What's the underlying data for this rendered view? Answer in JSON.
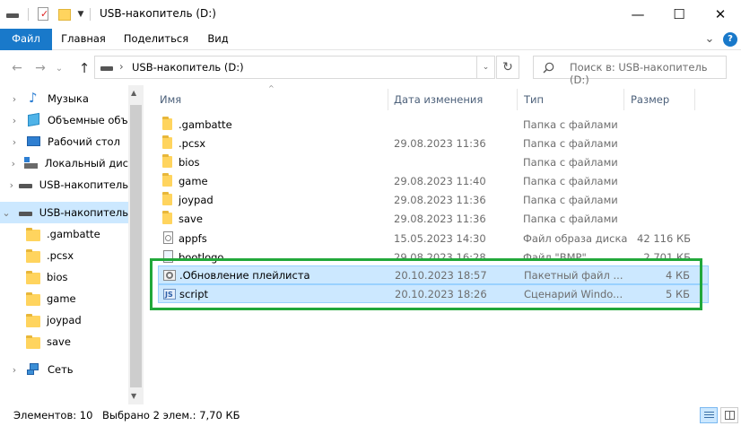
{
  "window": {
    "title": "USB-накопитель (D:)",
    "minimize_glyph": "—",
    "maximize_glyph": "☐",
    "close_glyph": "✕"
  },
  "ribbon": {
    "tabs": [
      "Файл",
      "Главная",
      "Поделиться",
      "Вид"
    ],
    "expand_glyph": "⌄",
    "help_glyph": "?"
  },
  "nav": {
    "back_glyph": "←",
    "forward_glyph": "→",
    "recent_glyph": "⌄",
    "up_glyph": "↑",
    "address_sep": "›",
    "address": "USB-накопитель (D:)",
    "refresh_glyph": "↻",
    "search_placeholder": "Поиск в: USB-накопитель (D:)"
  },
  "sidebar": {
    "items": [
      {
        "label": "Музыка",
        "icon": "music-icon"
      },
      {
        "label": "Объемные объ",
        "icon": "3d-objects-icon"
      },
      {
        "label": "Рабочий стол",
        "icon": "desktop-icon"
      },
      {
        "label": "Локальный дис",
        "icon": "local-disk-icon"
      },
      {
        "label": "USB-накопитель",
        "icon": "usb-drive-icon"
      },
      {
        "label": "USB-накопитель",
        "icon": "usb-drive-icon",
        "selected": true
      },
      {
        "label": ".gambatte",
        "icon": "folder-icon"
      },
      {
        "label": ".pcsx",
        "icon": "folder-icon"
      },
      {
        "label": "bios",
        "icon": "folder-icon"
      },
      {
        "label": "game",
        "icon": "folder-icon"
      },
      {
        "label": "joypad",
        "icon": "folder-icon"
      },
      {
        "label": "save",
        "icon": "folder-icon"
      },
      {
        "label": "Сеть",
        "icon": "network-icon"
      }
    ]
  },
  "columns": {
    "name": "Имя",
    "date": "Дата изменения",
    "type": "Тип",
    "size": "Размер"
  },
  "files": [
    {
      "name": ".gambatte",
      "date": "",
      "type": "Папка с файлами",
      "size": "",
      "icon": "folder-icon"
    },
    {
      "name": ".pcsx",
      "date": "29.08.2023 11:36",
      "type": "Папка с файлами",
      "size": "",
      "icon": "folder-icon"
    },
    {
      "name": "bios",
      "date": "",
      "type": "Папка с файлами",
      "size": "",
      "icon": "folder-icon"
    },
    {
      "name": "game",
      "date": "29.08.2023 11:40",
      "type": "Папка с файлами",
      "size": "",
      "icon": "folder-icon"
    },
    {
      "name": "joypad",
      "date": "29.08.2023 11:36",
      "type": "Папка с файлами",
      "size": "",
      "icon": "folder-icon"
    },
    {
      "name": "save",
      "date": "29.08.2023 11:36",
      "type": "Папка с файлами",
      "size": "",
      "icon": "folder-icon"
    },
    {
      "name": "appfs",
      "date": "15.05.2023 14:30",
      "type": "Файл образа диска",
      "size": "42 116 КБ",
      "icon": "disk-image-icon"
    },
    {
      "name": "bootlogo",
      "date": "29.08.2023 16:28",
      "type": "Файл \"BMP\"",
      "size": "2 701 КБ",
      "icon": "bmp-file-icon"
    },
    {
      "name": ".Обновление плейлиста",
      "date": "20.10.2023 18:57",
      "type": "Пакетный файл ...",
      "size": "4 КБ",
      "icon": "batch-file-icon",
      "selected": true
    },
    {
      "name": "script",
      "date": "20.10.2023 18:26",
      "type": "Сценарий Windo...",
      "size": "5 КБ",
      "icon": "script-file-icon",
      "selected": true
    }
  ],
  "status": {
    "count": "Элементов: 10",
    "selection": "Выбрано 2 элем.: 7,70 КБ"
  },
  "colors": {
    "accent": "#1979ca",
    "selection": "#cce8ff",
    "highlight_box": "#22a83a"
  }
}
